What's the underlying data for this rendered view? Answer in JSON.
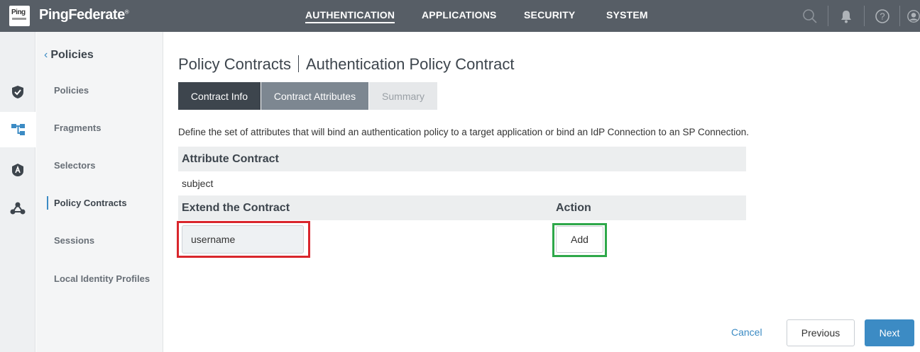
{
  "header": {
    "logo_text": "Ping",
    "brand": "PingFederate",
    "brand_mark": "®",
    "nav": [
      {
        "label": "AUTHENTICATION",
        "active": true
      },
      {
        "label": "APPLICATIONS",
        "active": false
      },
      {
        "label": "SECURITY",
        "active": false
      },
      {
        "label": "SYSTEM",
        "active": false
      }
    ],
    "icons": [
      "search-icon",
      "bell-icon",
      "help-icon",
      "user-icon"
    ]
  },
  "rail": {
    "items": [
      {
        "icon": "shield-check-icon",
        "active": false
      },
      {
        "icon": "hierarchy-icon",
        "active": true
      },
      {
        "icon": "badge-icon",
        "active": false
      },
      {
        "icon": "network-icon",
        "active": false
      }
    ]
  },
  "subnav": {
    "title": "Policies",
    "items": [
      {
        "label": "Policies"
      },
      {
        "label": "Fragments"
      },
      {
        "label": "Selectors"
      },
      {
        "label": "Policy Contracts",
        "active": true
      },
      {
        "label": "Sessions"
      },
      {
        "label": "Local Identity Profiles"
      }
    ]
  },
  "main": {
    "breadcrumb_parent": "Policy Contracts",
    "breadcrumb_current": "Authentication Policy Contract",
    "tabs": [
      {
        "label": "Contract Info"
      },
      {
        "label": "Contract Attributes"
      },
      {
        "label": "Summary"
      }
    ],
    "description": "Define the set of attributes that will bind an authentication policy to a target application or bind an IdP Connection to an SP Connection.",
    "attribute_contract_header": "Attribute Contract",
    "attribute_contract_rows": [
      "subject"
    ],
    "extend_header": "Extend the Contract",
    "action_header": "Action",
    "extend_input_value": "username",
    "add_label": "Add"
  },
  "footer": {
    "cancel_label": "Cancel",
    "previous_label": "Previous",
    "next_label": "Next"
  },
  "colors": {
    "topbar": "#575e66",
    "accent": "#3c8bc4",
    "active_tab": "#3d454d",
    "highlight_red": "#d9262c",
    "highlight_green": "#2ea84a"
  }
}
